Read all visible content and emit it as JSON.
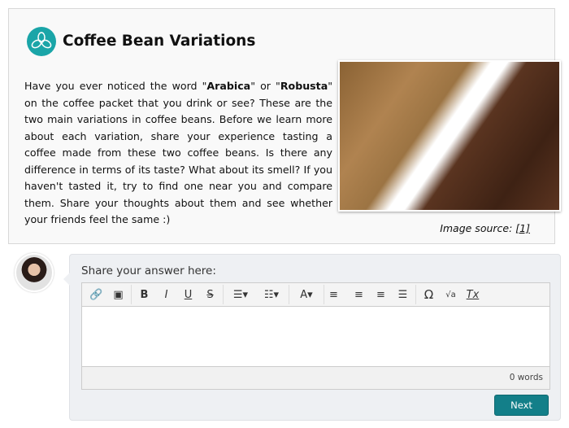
{
  "header": {
    "title": "Coffee Bean Variations",
    "icon": "coffee-beans-icon",
    "accent": "#1aa5a8"
  },
  "intro": {
    "parts": [
      "Have you ever noticed the word \"",
      "Arabica",
      "\" or \"",
      "Robusta",
      "\" on the coffee packet that you drink or see? These are the two main variations in coffee beans. Before we learn more about each variation, share your experience tasting a coffee made from these two coffee beans. Is there any difference in terms of its taste? What about its smell? If you haven't tasted it, try to find one near you and compare them. Share your thoughts about them and see whether your friends feel the same :)"
    ]
  },
  "image_source": {
    "label": "Image source: ",
    "link": "[1]"
  },
  "answer": {
    "label": "Share your answer here:",
    "toolbar": {
      "link": "🔗",
      "image": "▣",
      "bold": "B",
      "italic": "I",
      "underline": "U",
      "strike": "S",
      "bullets": "☰▾",
      "numbered": "☷▾",
      "color": "A▾",
      "left": "≡",
      "center": "≡",
      "right": "≡",
      "justify": "☰",
      "omega": "Ω",
      "math": "√a",
      "clear": "Tx"
    },
    "word_count": "0 words",
    "next_label": "Next",
    "button_color": "#137f89"
  }
}
